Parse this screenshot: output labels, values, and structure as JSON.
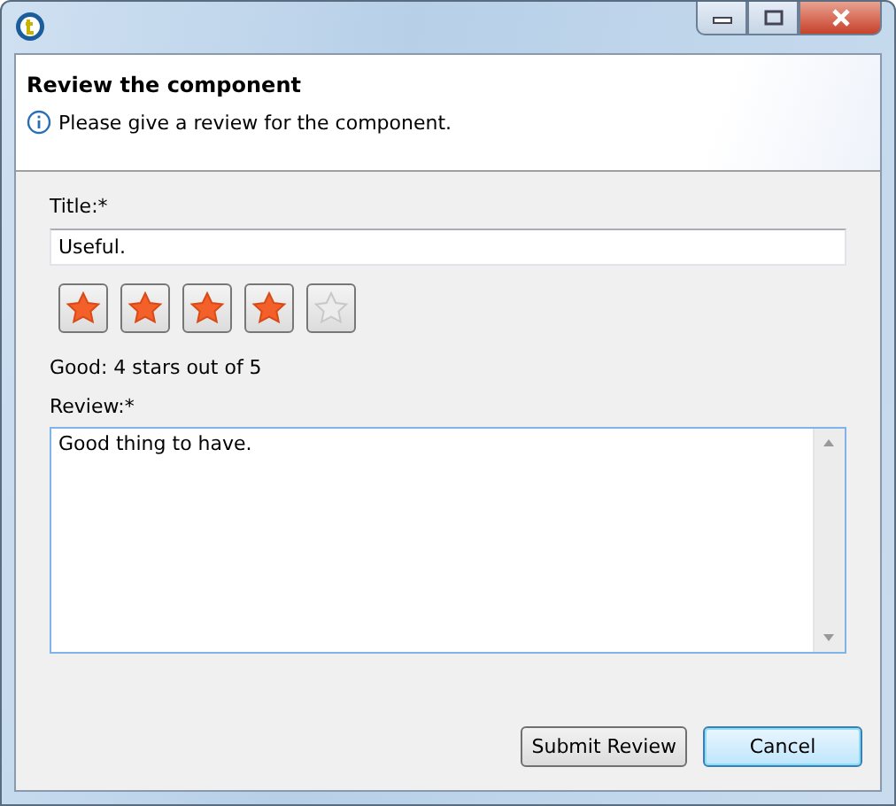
{
  "header": {
    "title": "Review the component",
    "message": "Please give a review for the component."
  },
  "form": {
    "title_label": "Title:*",
    "title_value": "Useful.",
    "stars": 4,
    "rating_text": "Good: 4 stars out of 5",
    "review_label": "Review:*",
    "review_value": "Good thing to have."
  },
  "buttons": [
    {
      "label": "Submit Review",
      "default": false
    },
    {
      "label": "Cancel",
      "default": true
    }
  ]
}
